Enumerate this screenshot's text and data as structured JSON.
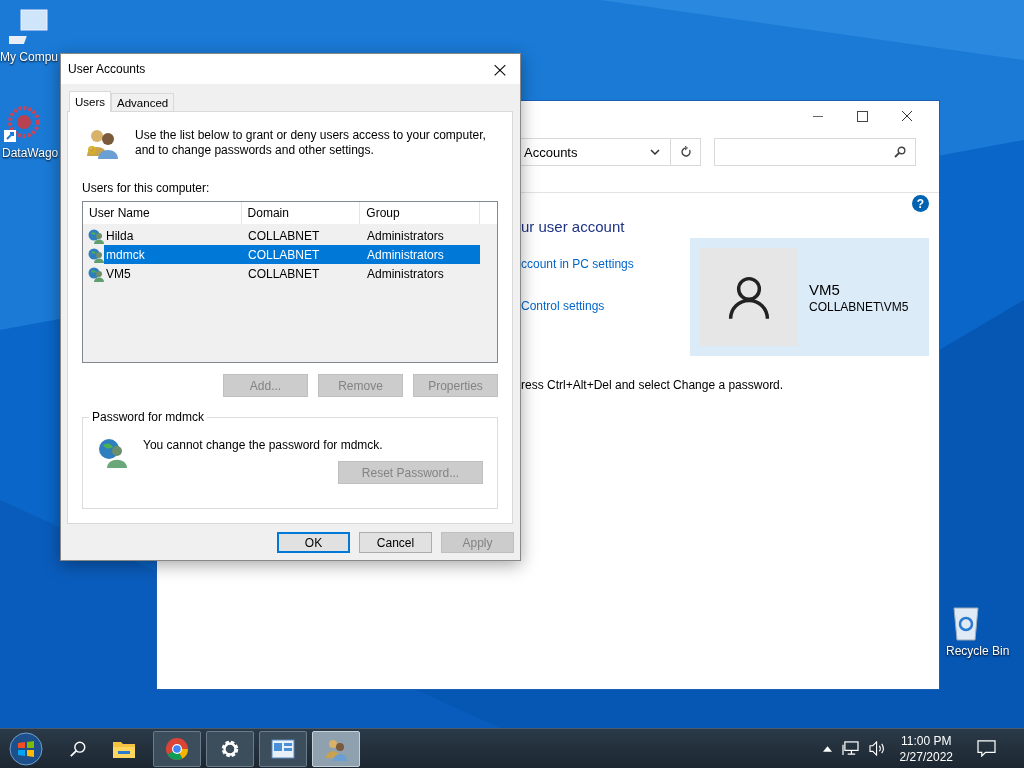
{
  "desktop_icons": [
    {
      "kind": "computer",
      "label": "My Compu"
    },
    {
      "kind": "app",
      "label": "DataWago"
    },
    {
      "kind": "recycle",
      "label": "Recycle Bin"
    }
  ],
  "background_window": {
    "address": "Accounts",
    "help": "?",
    "heading": "ur user account",
    "links": [
      "ccount in PC settings",
      "Control settings"
    ],
    "account": {
      "name": "VM5",
      "domain": "COLLABNET\\VM5"
    },
    "note": "ress Ctrl+Alt+Del and select Change a password."
  },
  "dialog": {
    "title": "User Accounts",
    "close": "×",
    "tabs": [
      {
        "label": "Users",
        "selected": true
      },
      {
        "label": "Advanced",
        "selected": false
      }
    ],
    "intro": "Use the list below to grant or deny users access to your computer, and to change passwords and other settings.",
    "list_label": "Users for this computer:",
    "columns": [
      "User Name",
      "Domain",
      "Group"
    ],
    "rows": [
      {
        "user": "Hilda",
        "domain": "COLLABNET",
        "group": "Administrators",
        "selected": false
      },
      {
        "user": "mdmck",
        "domain": "COLLABNET",
        "group": "Administrators",
        "selected": true
      },
      {
        "user": "VM5",
        "domain": "COLLABNET",
        "group": "Administrators",
        "selected": false
      }
    ],
    "list_buttons": [
      {
        "label": "Add...",
        "disabled": true
      },
      {
        "label": "Remove",
        "disabled": true
      },
      {
        "label": "Properties",
        "disabled": true
      }
    ],
    "password_group": {
      "title": "Password for mdmck",
      "message": "You cannot change the password for mdmck.",
      "button": {
        "label": "Reset Password...",
        "disabled": true
      }
    },
    "footer_buttons": [
      {
        "label": "OK",
        "disabled": false,
        "default": true
      },
      {
        "label": "Cancel",
        "disabled": false,
        "default": false
      },
      {
        "label": "Apply",
        "disabled": true,
        "default": false
      }
    ]
  },
  "taskbar": {
    "apps": [
      {
        "kind": "explorer",
        "running": false,
        "selected": false
      },
      {
        "kind": "chrome",
        "running": true,
        "selected": false
      },
      {
        "kind": "settings",
        "running": true,
        "selected": false
      },
      {
        "kind": "control-panel",
        "running": true,
        "selected": false
      },
      {
        "kind": "user-accounts",
        "running": true,
        "selected": true
      }
    ],
    "time": "11:00 PM",
    "date": "2/27/2022"
  }
}
